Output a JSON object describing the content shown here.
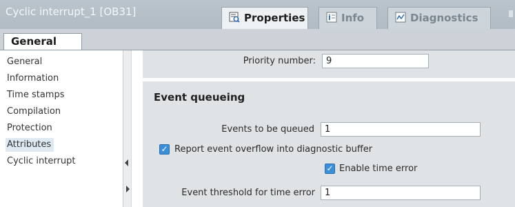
{
  "window": {
    "title": "Cyclic interrupt_1 [OB31]"
  },
  "top_tabs": [
    {
      "label": "Properties",
      "icon": "properties-icon",
      "active": true
    },
    {
      "label": "Info",
      "icon": "info-icon",
      "active": false
    },
    {
      "label": "Diagnostics",
      "icon": "diagnostics-icon",
      "active": false
    }
  ],
  "sub_tab": {
    "label": "General"
  },
  "nav": {
    "items": [
      {
        "label": "General",
        "selected": false
      },
      {
        "label": "Information",
        "selected": false
      },
      {
        "label": "Time stamps",
        "selected": false
      },
      {
        "label": "Compilation",
        "selected": false
      },
      {
        "label": "Protection",
        "selected": false
      },
      {
        "label": "Attributes",
        "selected": true
      },
      {
        "label": "Cyclic interrupt",
        "selected": false
      }
    ]
  },
  "priority": {
    "label": "Priority number:",
    "value": "9"
  },
  "event_queueing": {
    "title": "Event queueing",
    "events_label": "Events to be queued",
    "events_value": "1",
    "report_overflow_label": "Report event overflow into diagnostic buffer",
    "report_overflow_checked": true,
    "enable_time_error_label": "Enable time error",
    "enable_time_error_checked": true,
    "threshold_label": "Event threshold for time error",
    "threshold_value": "1"
  },
  "colors": {
    "accent": "#3b8fd8",
    "titlebar": "#b6c0c8",
    "panel": "#dfe3e6"
  }
}
